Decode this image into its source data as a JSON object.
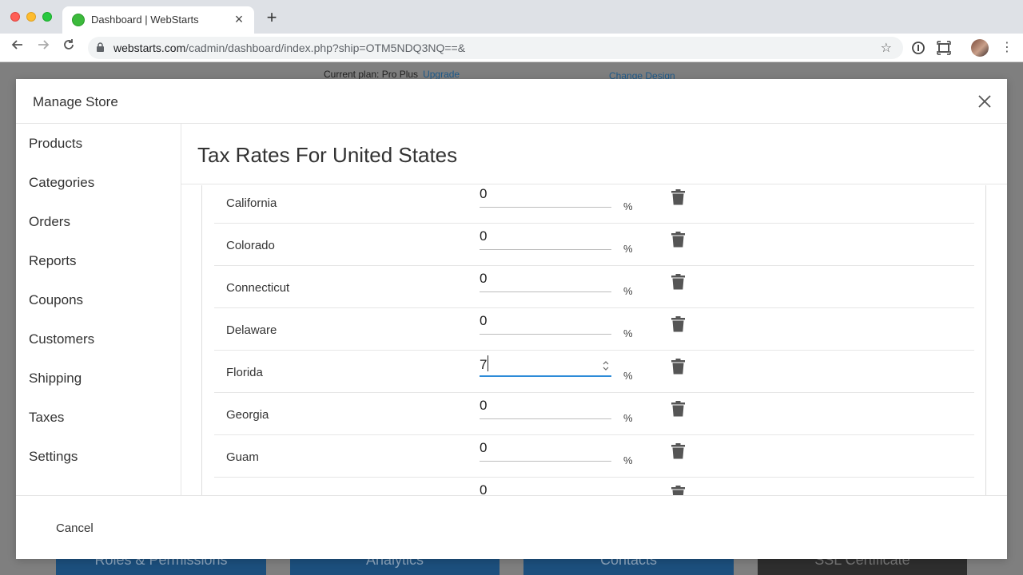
{
  "browser": {
    "tab_title": "Dashboard | WebStarts",
    "url_host": "webstarts.com",
    "url_path": "/cadmin/dashboard/index.php?ship=OTM5NDQ3NQ==&"
  },
  "page": {
    "plan_label": "Current plan: Pro Plus",
    "upgrade_link": "Upgrade",
    "change_design_link": "Change Design",
    "tiles": [
      "Roles & Permissions",
      "Analytics",
      "Contacts",
      "SSL Certificate"
    ]
  },
  "modal": {
    "title": "Manage Store",
    "sidebar": [
      {
        "label": "Products"
      },
      {
        "label": "Categories"
      },
      {
        "label": "Orders"
      },
      {
        "label": "Reports"
      },
      {
        "label": "Coupons"
      },
      {
        "label": "Customers"
      },
      {
        "label": "Shipping"
      },
      {
        "label": "Taxes"
      },
      {
        "label": "Settings"
      }
    ],
    "content_title": "Tax Rates For United States",
    "percent_symbol": "%",
    "rows": [
      {
        "state": "California",
        "rate": "0"
      },
      {
        "state": "Colorado",
        "rate": "0"
      },
      {
        "state": "Connecticut",
        "rate": "0"
      },
      {
        "state": "Delaware",
        "rate": "0"
      },
      {
        "state": "Florida",
        "rate": "7"
      },
      {
        "state": "Georgia",
        "rate": "0"
      },
      {
        "state": "Guam",
        "rate": "0"
      },
      {
        "state": "",
        "rate": "0"
      }
    ],
    "cancel_label": "Cancel"
  }
}
